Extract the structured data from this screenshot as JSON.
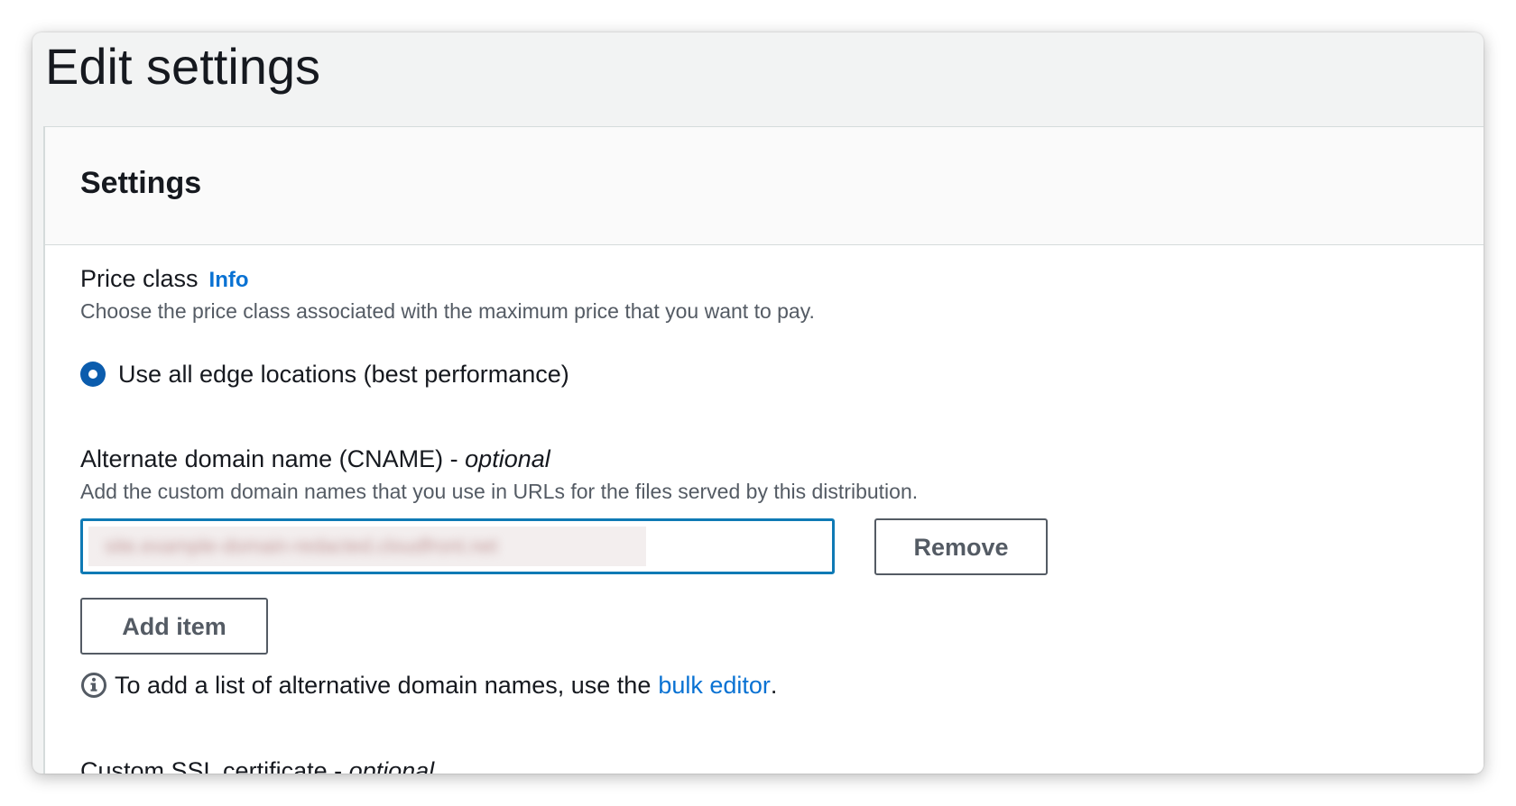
{
  "page": {
    "title": "Edit settings"
  },
  "settings_panel": {
    "title": "Settings",
    "price_class": {
      "label": "Price class",
      "info_link": "Info",
      "description": "Choose the price class associated with the maximum price that you want to pay.",
      "selected_option": "Use all edge locations (best performance)"
    },
    "cname": {
      "label": "Alternate domain name (CNAME) - ",
      "optional": "optional",
      "description": "Add the custom domain names that you use in URLs for the files served by this distribution.",
      "value": "site.example-domain-redacted.cloudfront.net",
      "remove_label": "Remove",
      "add_item_label": "Add item",
      "note_prefix": "To add a list of alternative domain names, use the",
      "note_link": "bulk editor",
      "note_suffix": "."
    },
    "ssl": {
      "label": "Custom SSL certificate - ",
      "optional": "optional"
    }
  },
  "colors": {
    "accent": "#0972d3",
    "radio_selected": "#0b5cad",
    "input_focus": "#0f7ab5",
    "text": "#16191f",
    "secondary_text": "#545b64",
    "header_bg": "#f2f3f3"
  }
}
